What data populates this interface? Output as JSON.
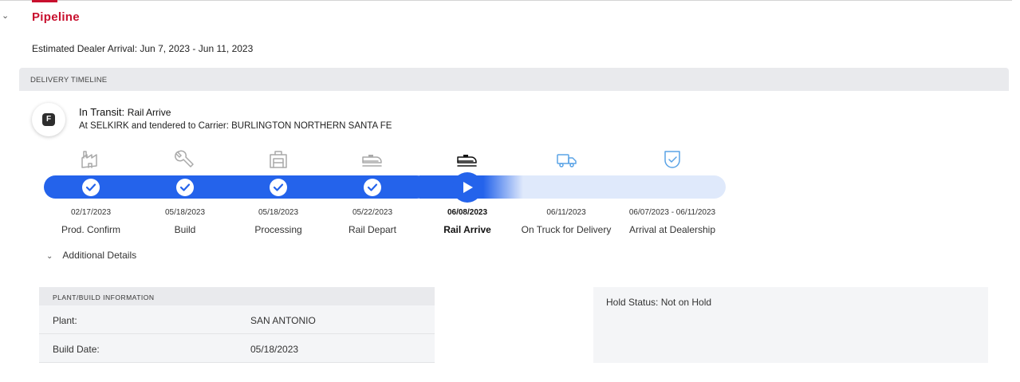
{
  "section": {
    "title": "Pipeline",
    "estimated_arrival": "Estimated Dealer Arrival: Jun 7, 2023 - Jun 11, 2023"
  },
  "panel": {
    "header": "DELIVERY TIMELINE",
    "badge_letter": "F",
    "status_title": "In Transit:",
    "status_sub": "Rail Arrive",
    "status_desc": "At SELKIRK and tendered to Carrier: BURLINGTON NORTHERN SANTA FE"
  },
  "timeline": {
    "accent_color": "#2463eb",
    "pending_color": "#dfe9fb",
    "completed_icon_color": "#a9a9a9",
    "current_icon_color": "#111111",
    "future_icon_color": "#5aa3e6",
    "steps": [
      {
        "date": "02/17/2023",
        "label": "Prod. Confirm",
        "state": "done",
        "icon": "factory-icon"
      },
      {
        "date": "05/18/2023",
        "label": "Build",
        "state": "done",
        "icon": "wrench-icon"
      },
      {
        "date": "05/18/2023",
        "label": "Processing",
        "state": "done",
        "icon": "processing-icon"
      },
      {
        "date": "05/22/2023",
        "label": "Rail Depart",
        "state": "done",
        "icon": "rail-depart-icon"
      },
      {
        "date": "06/08/2023",
        "label": "Rail Arrive",
        "state": "current",
        "icon": "rail-arrive-icon"
      },
      {
        "date": "06/11/2023",
        "label": "On Truck for Delivery",
        "state": "pending",
        "icon": "truck-icon"
      },
      {
        "date": "06/07/2023 - 06/11/2023",
        "label": "Arrival at Dealership",
        "state": "pending",
        "icon": "dealership-shield-icon"
      }
    ]
  },
  "additional": {
    "label": "Additional Details"
  },
  "plant": {
    "header": "PLANT/BUILD INFORMATION",
    "rows": [
      {
        "key": "Plant:",
        "value": "SAN ANTONIO"
      },
      {
        "key": "Build Date:",
        "value": "05/18/2023"
      }
    ]
  },
  "hold": {
    "text": "Hold Status: Not on Hold"
  }
}
